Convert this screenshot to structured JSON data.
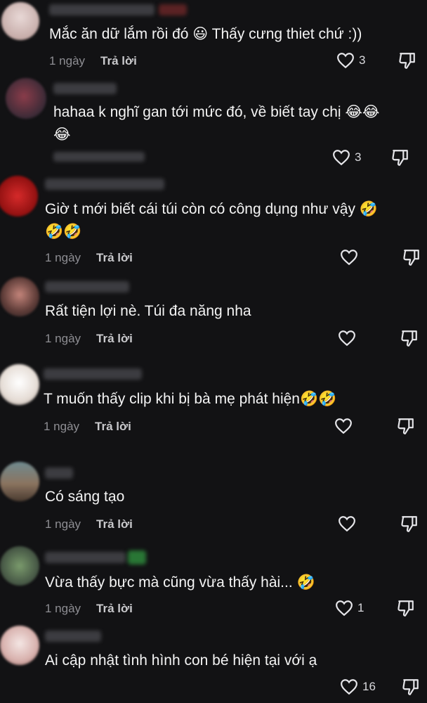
{
  "comments": [
    {
      "text": "Mắc ăn dữ lắm rồi đó 😃 Thấy cưng thiet chứ :))",
      "time": "1 ngày",
      "reply": "Trả lời",
      "likes": "3"
    },
    {
      "text": "hahaa k nghĩ gan tới mức đó, về biết tay chị 😂😂\n😂",
      "time": "",
      "reply": "",
      "likes": "3"
    },
    {
      "text": "Giờ t mới biết cái túi còn có công dụng như vậy 🤣\n🤣🤣",
      "time": "1 ngày",
      "reply": "Trả lời",
      "likes": ""
    },
    {
      "text": "Rất tiện lợi nè. Túi đa năng nha",
      "time": "1 ngày",
      "reply": "Trả lời",
      "likes": ""
    },
    {
      "text": "T muốn thấy clip khi bị bà mẹ phát hiện🤣🤣",
      "time": "1 ngày",
      "reply": "Trả lời",
      "likes": ""
    },
    {
      "text": "Có sáng tạo",
      "time": "1 ngày",
      "reply": "Trả lời",
      "likes": ""
    },
    {
      "text": "Vừa thấy bực mà cũng vừa thấy hài... 🤣",
      "time": "1 ngày",
      "reply": "Trả lời",
      "likes": "1"
    },
    {
      "text": "Ai cập nhật tình hình con bé hiện tại với ạ",
      "time": "",
      "reply": "",
      "likes": "16"
    }
  ],
  "icons": {
    "like": "heart-outline-icon",
    "dislike": "thumbs-down-icon"
  },
  "colors": {
    "background": "#121214",
    "text": "#f4f4f4",
    "meta": "#8e8e93"
  }
}
